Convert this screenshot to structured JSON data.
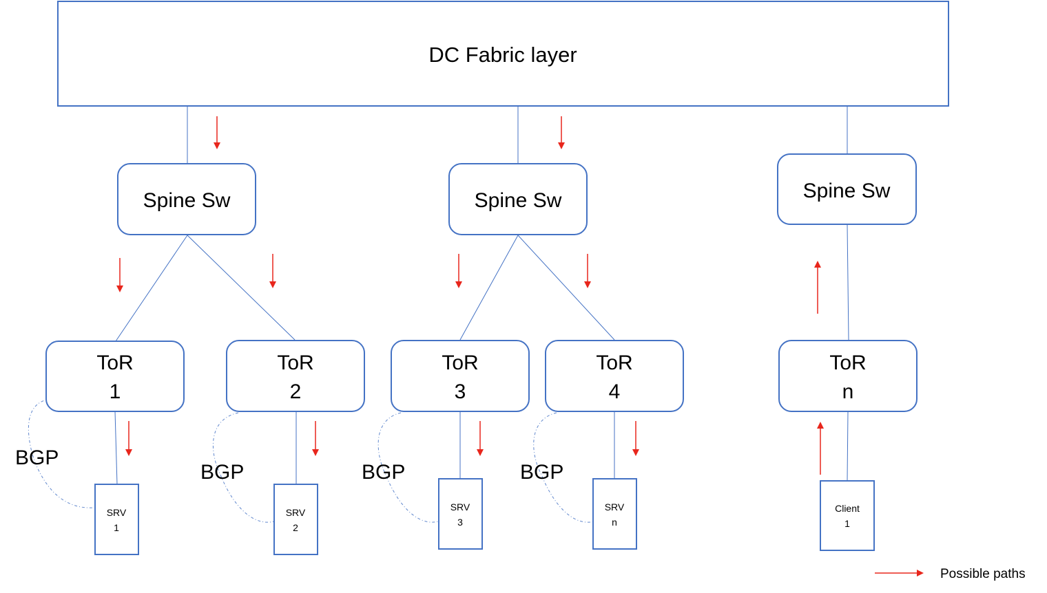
{
  "colors": {
    "box_stroke": "#4472C4",
    "path_arrow": "#E8261C",
    "text": "#000000"
  },
  "fabric": {
    "label": "DC Fabric layer"
  },
  "spines": [
    {
      "id": "spine-1",
      "label": "Spine Sw"
    },
    {
      "id": "spine-2",
      "label": "Spine Sw"
    },
    {
      "id": "spine-3",
      "label": "Spine Sw"
    }
  ],
  "tors": [
    {
      "id": "tor-1",
      "line1": "ToR",
      "line2": "1",
      "spine": "spine-1"
    },
    {
      "id": "tor-2",
      "line1": "ToR",
      "line2": "2",
      "spine": "spine-1"
    },
    {
      "id": "tor-3",
      "line1": "ToR",
      "line2": "3",
      "spine": "spine-2"
    },
    {
      "id": "tor-4",
      "line1": "ToR",
      "line2": "4",
      "spine": "spine-2"
    },
    {
      "id": "tor-n",
      "line1": "ToR",
      "line2": "n",
      "spine": "spine-3"
    }
  ],
  "hosts": [
    {
      "id": "srv-1",
      "line1": "SRV",
      "line2": "1",
      "tor": "tor-1",
      "bgp": true
    },
    {
      "id": "srv-2",
      "line1": "SRV",
      "line2": "2",
      "tor": "tor-2",
      "bgp": true
    },
    {
      "id": "srv-3",
      "line1": "SRV",
      "line2": "3",
      "tor": "tor-3",
      "bgp": true
    },
    {
      "id": "srv-n",
      "line1": "SRV",
      "line2": "n",
      "tor": "tor-4",
      "bgp": true
    },
    {
      "id": "client-1",
      "line1": "Client",
      "line2": "1",
      "tor": "tor-n",
      "bgp": false
    }
  ],
  "bgp_label": "BGP",
  "path_directions": {
    "fabric_to_spine_1": "down",
    "fabric_to_spine_2": "down",
    "spine_1_to_tor_1": "down",
    "spine_1_to_tor_2": "down",
    "spine_2_to_tor_3": "down",
    "spine_2_to_tor_4": "down",
    "tor_1_to_srv_1": "down",
    "tor_2_to_srv_2": "down",
    "tor_3_to_srv_3": "down",
    "tor_4_to_srv_n": "down",
    "tor_n_to_spine_3": "up",
    "client_1_to_tor_n": "up"
  },
  "legend": {
    "label": "Possible paths"
  }
}
